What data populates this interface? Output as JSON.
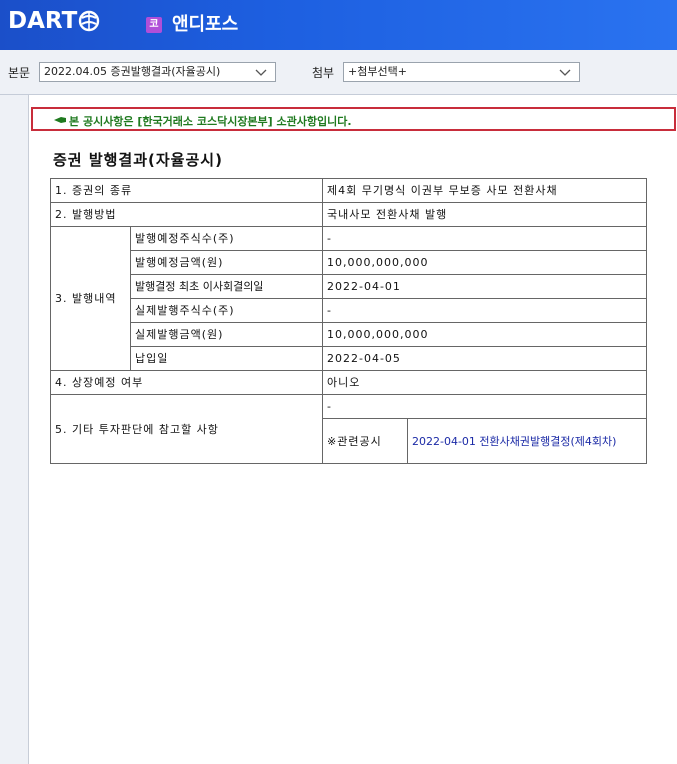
{
  "header": {
    "logo_text": "DART",
    "company_badge": "코",
    "company_name": "앤디포스"
  },
  "toolbar": {
    "main_label": "본문",
    "main_select": "2022.04.05  증권발행결과(자율공시)",
    "attach_label": "첨부",
    "attach_select": "+첨부선택+"
  },
  "notice": {
    "text": "본 공시사항은 [한국거래소 코스닥시장본부] 소관사항입니다."
  },
  "document": {
    "title": "증권 발행결과(자율공시)",
    "rows": {
      "r1_label": "1. 증권의 종류",
      "r1_value": "제4회 무기명식 이권부 무보증 사모 전환사채",
      "r2_label": "2. 발행방법",
      "r2_value": "국내사모 전환사채 발행",
      "r3_label": "3. 발행내역",
      "r3_sub": [
        {
          "label": "발행예정주식수(주)",
          "value": "-"
        },
        {
          "label": "발행예정금액(원)",
          "value": "10,000,000,000"
        },
        {
          "label": "발행결정 최초 이사회결의일",
          "value": "2022-04-01"
        },
        {
          "label": "실제발행주식수(주)",
          "value": "-"
        },
        {
          "label": "실제발행금액(원)",
          "value": "10,000,000,000"
        },
        {
          "label": "납입일",
          "value": "2022-04-05"
        }
      ],
      "r4_label": "4. 상장예정 여부",
      "r4_value": "아니오",
      "r5_label": "5. 기타 투자판단에 참고할 사항",
      "r5_value": "-",
      "r5_related_label": "※관련공시",
      "r5_related_link": "2022-04-01 전환사채권발행결정(제4회차)"
    }
  }
}
